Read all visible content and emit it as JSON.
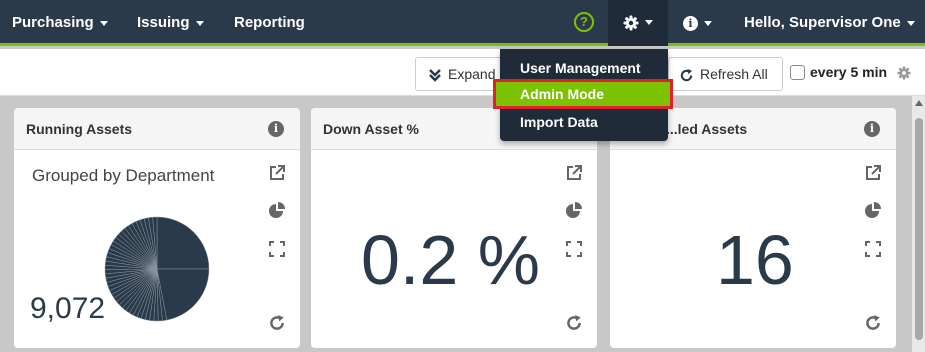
{
  "nav": {
    "purchasing": "Purchasing",
    "issuing": "Issuing",
    "reporting": "Reporting",
    "help_glyph": "?",
    "info_glyph": "i",
    "user_greeting": "Hello, Supervisor One"
  },
  "settings_menu": {
    "items": [
      "User Management",
      "Admin Mode",
      "Import Data"
    ],
    "active_item": "Admin Mode"
  },
  "toolbar": {
    "expand_label": "Expand",
    "refresh_label": "Refresh All",
    "auto_refresh_label": "every 5 min",
    "auto_refresh_checked": false
  },
  "cards": [
    {
      "title": "Running Assets",
      "subtitle": "Grouped by Department",
      "value": "9,072"
    },
    {
      "title": "Down Asset %",
      "value": "0.2 %"
    },
    {
      "title": "...led Assets",
      "value": "16"
    }
  ],
  "colors": {
    "nav_bg": "#2b3a4a",
    "accent_green": "#7cc200",
    "highlight_red": "#e0202a",
    "value_text": "#2b3a4a"
  }
}
